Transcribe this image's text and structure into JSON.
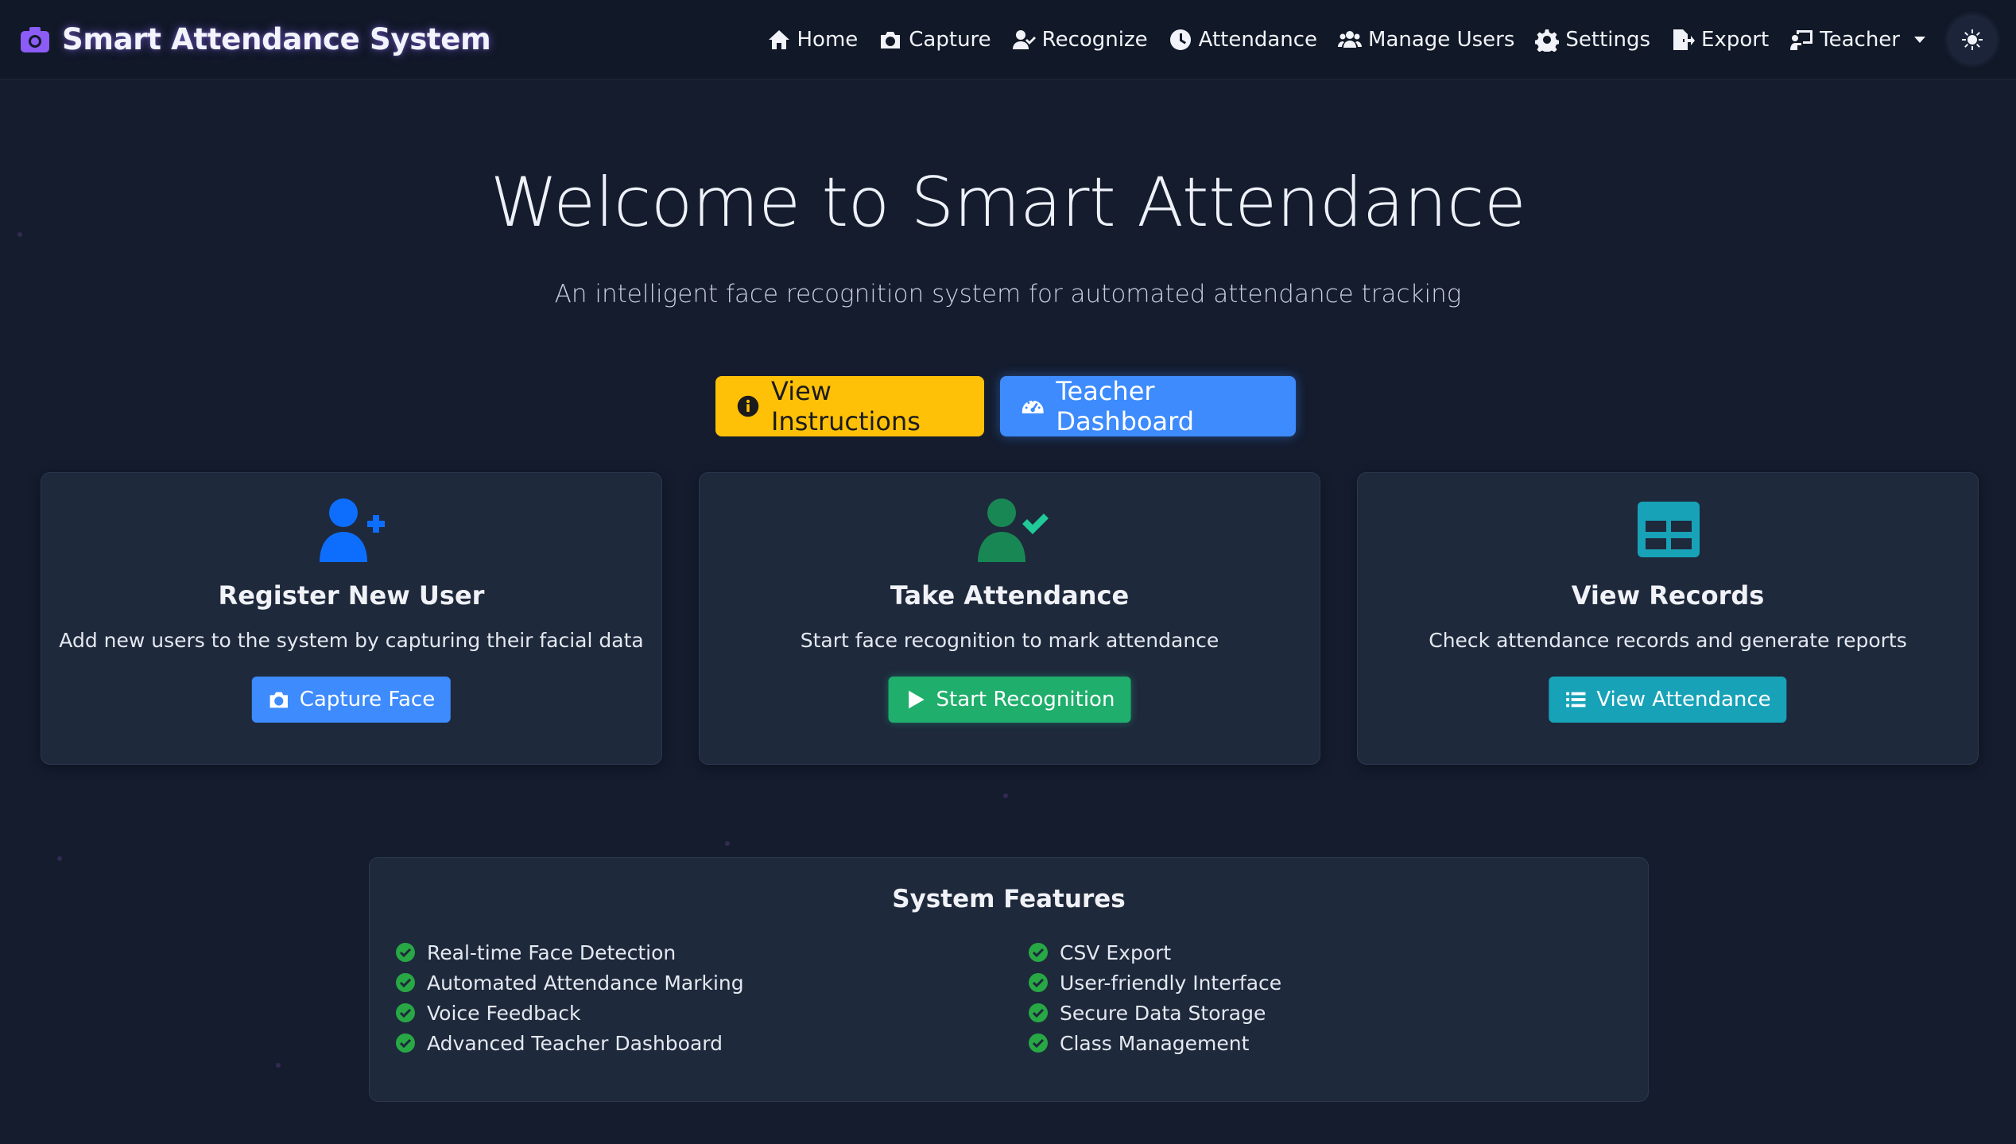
{
  "app": {
    "brand_title": "Smart Attendance System",
    "accent_color": "#8b5cf6"
  },
  "nav": {
    "items": [
      {
        "label": "Home",
        "icon": "home-icon"
      },
      {
        "label": "Capture",
        "icon": "camera-icon"
      },
      {
        "label": "Recognize",
        "icon": "user-check-icon"
      },
      {
        "label": "Attendance",
        "icon": "clock-icon"
      },
      {
        "label": "Manage Users",
        "icon": "users-icon"
      },
      {
        "label": "Settings",
        "icon": "gear-icon"
      },
      {
        "label": "Export",
        "icon": "file-export-icon"
      },
      {
        "label": "Teacher",
        "icon": "chalkboard-teacher-icon"
      }
    ],
    "theme_toggle_icon": "sun-icon"
  },
  "hero": {
    "title": "Welcome to Smart Attendance",
    "subtitle": "An intelligent face recognition system for automated attendance tracking",
    "instructions_label": "View Instructions",
    "dashboard_label": "Teacher Dashboard"
  },
  "cards": [
    {
      "title": "Register New User",
      "text": "Add new users to the system by capturing their facial data",
      "button": "Capture Face",
      "icon": "user-plus-icon",
      "color": "#0d6efd"
    },
    {
      "title": "Take Attendance",
      "text": "Start face recognition to mark attendance",
      "button": "Start Recognition",
      "icon": "user-check-icon",
      "color": "#198754"
    },
    {
      "title": "View Records",
      "text": "Check attendance records and generate reports",
      "button": "View Attendance",
      "icon": "table-icon",
      "color": "#17a2b8"
    }
  ],
  "features": {
    "title": "System Features",
    "left": [
      "Real-time Face Detection",
      "Automated Attendance Marking",
      "Voice Feedback",
      "Advanced Teacher Dashboard"
    ],
    "right": [
      "CSV Export",
      "User-friendly Interface",
      "Secure Data Storage",
      "Class Management"
    ],
    "check_color": "#28a745"
  }
}
